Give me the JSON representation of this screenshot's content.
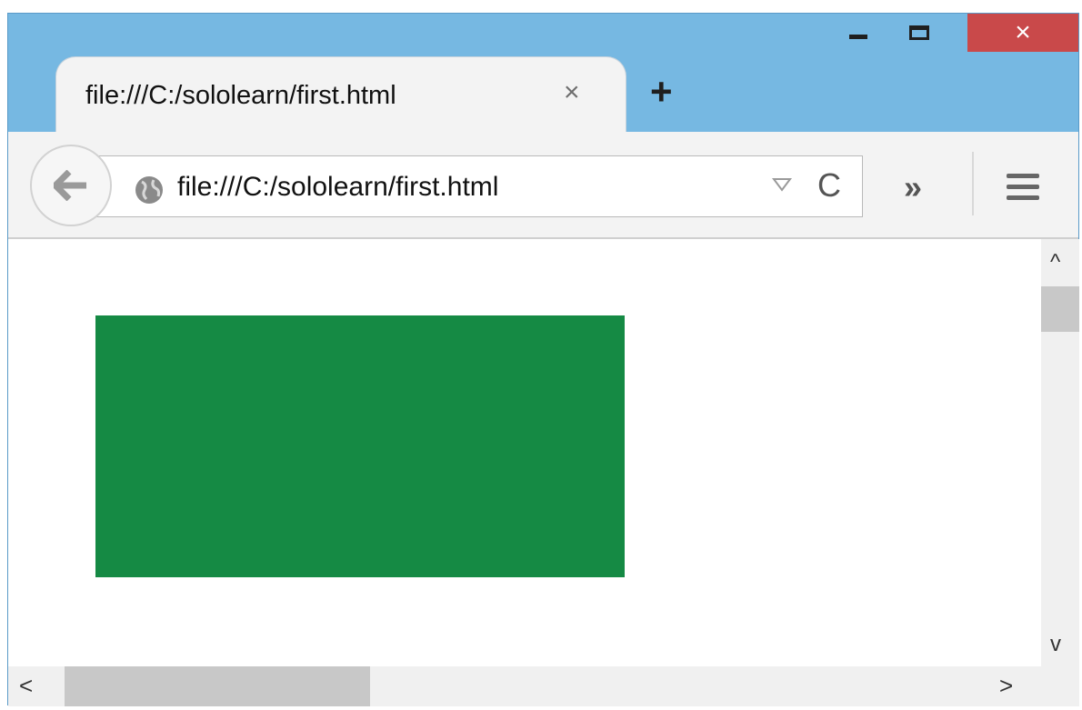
{
  "window": {
    "controls": {
      "minimize_icon": "minimize-icon",
      "maximize_icon": "maximize-icon",
      "close_glyph": "×"
    }
  },
  "tab": {
    "title": "file:///C:/sololearn/first.html",
    "close_glyph": "×"
  },
  "new_tab_glyph": "+",
  "navbar": {
    "url": "file:///C:/sololearn/first.html",
    "reload_glyph": "C",
    "overflow_glyph": "»"
  },
  "content": {
    "box_color": "#158a44"
  },
  "scrollbars": {
    "up_glyph": "^",
    "down_glyph": "v",
    "left_glyph": "<",
    "right_glyph": ">"
  }
}
